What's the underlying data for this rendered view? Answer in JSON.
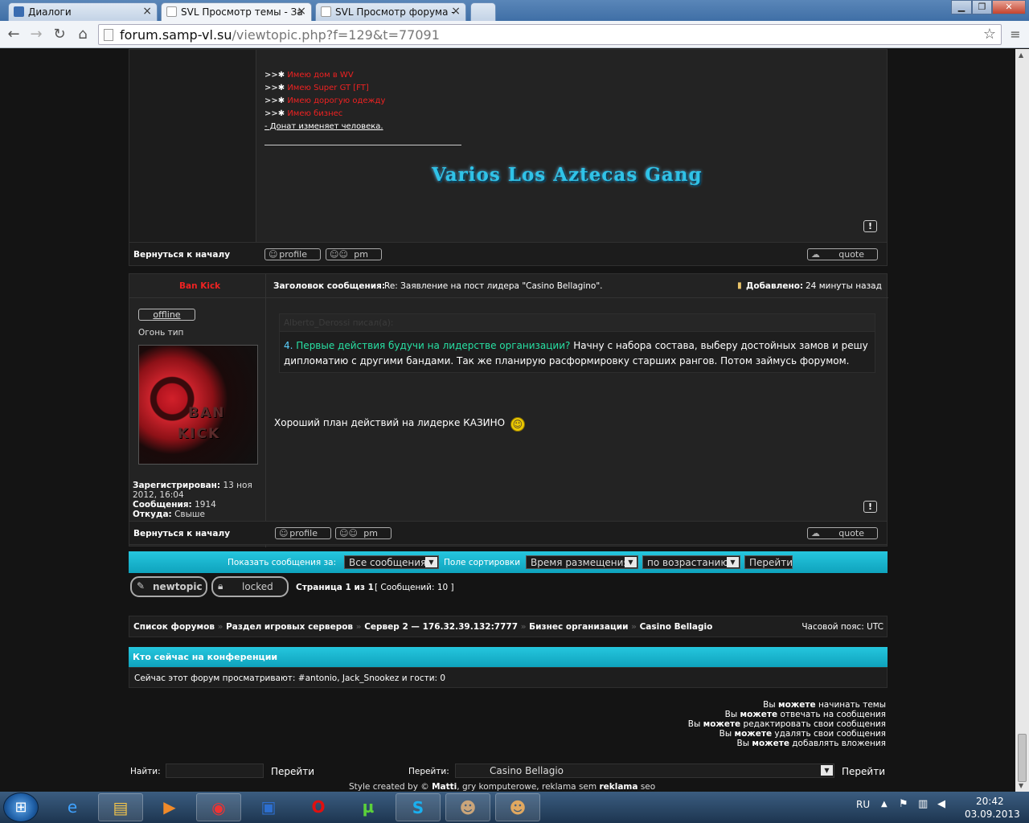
{
  "browser": {
    "tabs": [
      {
        "title": "Диалоги"
      },
      {
        "title": "SVL Просмотр темы - За"
      },
      {
        "title": "SVL Просмотр форума -"
      }
    ],
    "url_host": "forum.samp-vl.su",
    "url_path": "/viewtopic.php?f=129&t=77091"
  },
  "prev_post": {
    "lines": [
      {
        "prefix": ">>",
        "text": "Имею дом в WV"
      },
      {
        "prefix": ">>",
        "text": "Имею Super GT [FT]"
      },
      {
        "prefix": ">>",
        "text": "Имею дорогую одежду"
      },
      {
        "prefix": ">>",
        "text": "Имею бизнес"
      }
    ],
    "motto": "- Донат изменяет человека.",
    "banner": "Varios Los Aztecas Gang",
    "back_to_top": "Вернуться к началу",
    "profile": "profile",
    "pm": "pm",
    "quote": "quote"
  },
  "post": {
    "author": "Ban Kick",
    "subject_label": "Заголовок сообщения:",
    "subject": "Re: Заявление на пост лидера \"Casino Bellagino\".",
    "added_label": "Добавлено:",
    "added": "24 минуты назад",
    "status": "offline",
    "rank": "Огонь тип",
    "avatar_text1": "BAN",
    "avatar_text2": "KICK",
    "registered_label": "Зарегистрирован:",
    "registered_1": "13 ноя",
    "registered_2": "2012, 16:04",
    "posts_label": "Сообщения:",
    "posts": "1914",
    "from_label": "Откуда:",
    "from": "Свыше",
    "quote_header": "Alberto_Derossi писал(а):",
    "quote_num": "4.",
    "quote_question": "Первые действия будучи на лидерстве организации?",
    "quote_line1": "Начну с набора состава, выберу достойных замов и решу",
    "quote_line2": "дипломатию с другими бандами. Так же планирую расформировку старших рангов. Потом займусь форумом.",
    "reply": "Хороший план действий на лидерке КАЗИНО",
    "back_to_top": "Вернуться к началу",
    "profile": "profile",
    "pm": "pm",
    "quote": "quote"
  },
  "sortbar": {
    "show_label": "Показать сообщения за:",
    "show_value": "Все сообщения",
    "sort_label": "Поле сортировки",
    "sort_value": "Время размещения",
    "order_value": "по возрастанию",
    "go": "Перейти"
  },
  "pagination": {
    "newtopic": "newtopic",
    "locked": "locked",
    "page": "Страница 1 из 1",
    "count": "[ Сообщений: 10 ]"
  },
  "breadcrumbs": {
    "items": [
      "Список форумов",
      "Раздел игровых серверов",
      "Сервер 2 — 176.32.39.132:7777",
      "Бизнес организации",
      "Casino Bellagio"
    ],
    "timezone": "Часовой пояс: UTC"
  },
  "online": {
    "title": "Кто сейчас на конференции",
    "text": "Сейчас этот форум просматривают: #antonio, Jack_Snookez и гости: 0"
  },
  "permissions": {
    "you": "Вы",
    "can": "можете",
    "items": [
      "начинать темы",
      "отвечать на сообщения",
      "редактировать свои сообщения",
      "удалять свои сообщения",
      "добавлять вложения"
    ]
  },
  "footer": {
    "search_label": "Найти:",
    "search_go": "Перейти",
    "jump_label": "Перейти:",
    "jump_value": "Casino Bellagio",
    "jump_go": "Перейти",
    "credit_1": "Style created by ©",
    "credit_2": "Matti",
    "credit_3": ", gry komputerowe, reklama sem",
    "credit_4": "reklama",
    "credit_5": "seo"
  },
  "taskbar": {
    "lang": "RU",
    "time": "20:42",
    "date": "03.09.2013"
  }
}
